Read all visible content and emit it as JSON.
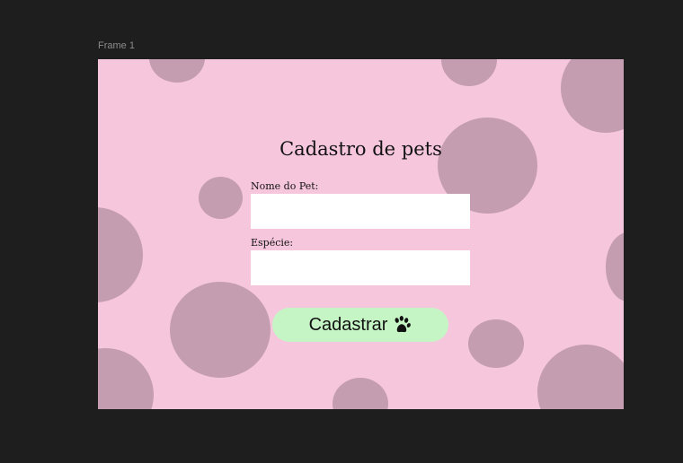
{
  "canvas": {
    "frame_name": "Frame 1"
  },
  "form": {
    "title": "Cadastro de pets",
    "fields": [
      {
        "label": "Nome do Pet:",
        "value": "",
        "placeholder": ""
      },
      {
        "label": "Espécie:",
        "value": "",
        "placeholder": ""
      }
    ],
    "submit_label": "Cadastrar",
    "submit_icon": "paw-icon"
  },
  "colors": {
    "editor_background": "#1e1e1e",
    "frame_background": "#f6c6dd",
    "circle_fill": "#c49db0",
    "button_background": "#c6f5c5",
    "input_background": "#ffffff"
  }
}
